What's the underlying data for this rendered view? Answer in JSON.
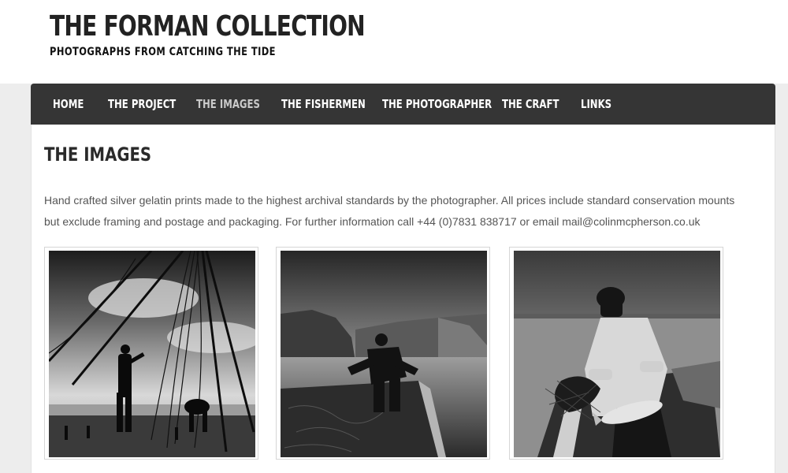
{
  "site": {
    "title": "THE FORMAN COLLECTION",
    "subtitle": "PHOTOGRAPHS FROM CATCHING THE TIDE"
  },
  "nav": {
    "items": [
      {
        "label": "HOME"
      },
      {
        "label": "THE PROJECT"
      },
      {
        "label": "THE IMAGES"
      },
      {
        "label": "THE FISHERMEN"
      },
      {
        "label": "THE PHOTOGRAPHER"
      },
      {
        "label": "THE CRAFT"
      },
      {
        "label": "LINKS"
      }
    ],
    "active": "THE IMAGES"
  },
  "page": {
    "title": "THE IMAGES",
    "intro_line1": "Hand crafted silver gelatin prints made to the highest archival standards by the photographer. All prices include standard conservation mounts",
    "intro_line2": "but exclude framing and postage and packaging. For further information call +44 (0)7831 838717 or email mail@colinmcpherson.co.uk"
  },
  "gallery": [
    {
      "subject": "photo-nets-poles"
    },
    {
      "subject": "photo-cliffs-boat"
    },
    {
      "subject": "photo-fisherman-salmon"
    }
  ],
  "colors": {
    "nav_bg": "#353535",
    "nav_text": "#ffffff",
    "nav_active": "#c9c9c9",
    "body_text": "#555555"
  }
}
